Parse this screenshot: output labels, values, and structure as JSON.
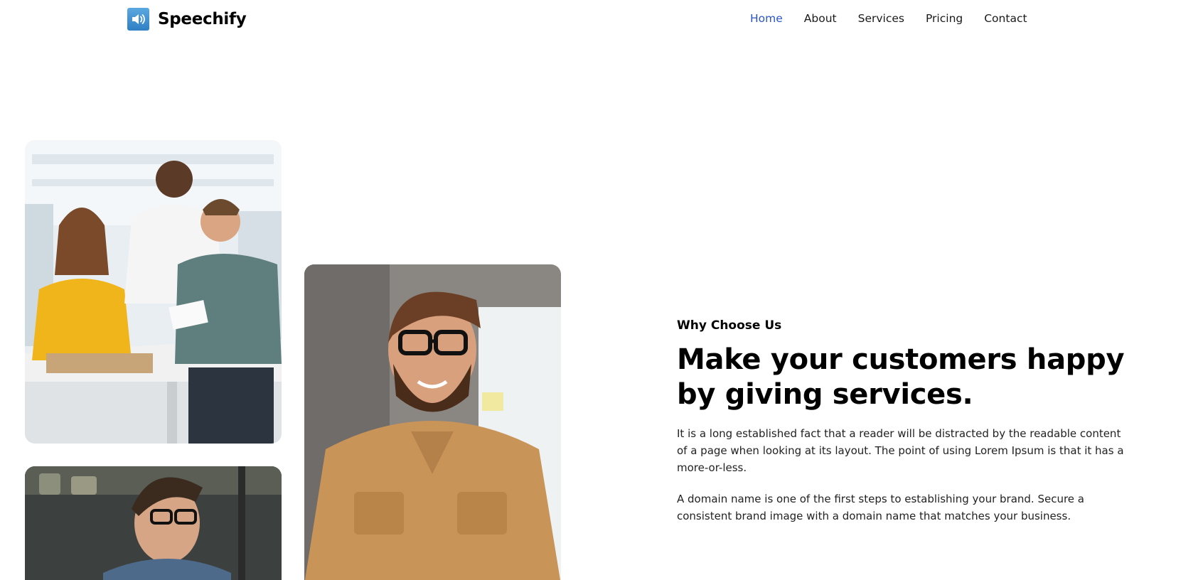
{
  "header": {
    "brand_name": "Speechify",
    "brand_icon": "speaker-icon",
    "nav": [
      {
        "label": "Home",
        "active": true
      },
      {
        "label": "About",
        "active": false
      },
      {
        "label": "Services",
        "active": false
      },
      {
        "label": "Pricing",
        "active": false
      },
      {
        "label": "Contact",
        "active": false
      }
    ]
  },
  "main": {
    "eyebrow": "Why Choose Us",
    "headline": "Make your customers happy by giving services.",
    "paragraphs": [
      "It is a long established fact that a reader will be distracted by the readable content of a page when looking at its layout. The point of using Lorem Ipsum is that it has a more-or-less.",
      "A domain name is one of the first steps to establishing your brand. Secure a consistent brand image with a domain name that matches your business."
    ]
  },
  "colors": {
    "nav_active": "#2a55c7",
    "text": "#111111",
    "background": "#ffffff"
  }
}
